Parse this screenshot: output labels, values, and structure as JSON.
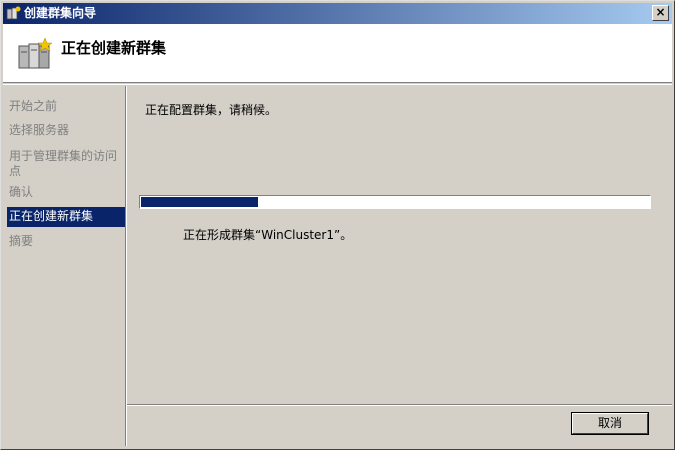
{
  "window": {
    "title": "创建群集向导",
    "close_glyph": "×"
  },
  "header": {
    "title": "正在创建新群集",
    "icon": "cluster-servers-icon"
  },
  "nav": {
    "items": [
      {
        "label": "开始之前",
        "active": false
      },
      {
        "label": "选择服务器",
        "active": false
      },
      {
        "label": "用于管理群集的访问点",
        "active": false
      },
      {
        "label": "确认",
        "active": false
      },
      {
        "label": "正在创建新群集",
        "active": true
      },
      {
        "label": "摘要",
        "active": false
      }
    ]
  },
  "content": {
    "status": "正在配置群集，请稍候。",
    "progress_fraction": 0.23,
    "detail": "正在形成群集“WinCluster1”。"
  },
  "footer": {
    "cancel_label": "取消"
  },
  "colors": {
    "accent": "#0a246a",
    "background": "#d4d0c8"
  }
}
